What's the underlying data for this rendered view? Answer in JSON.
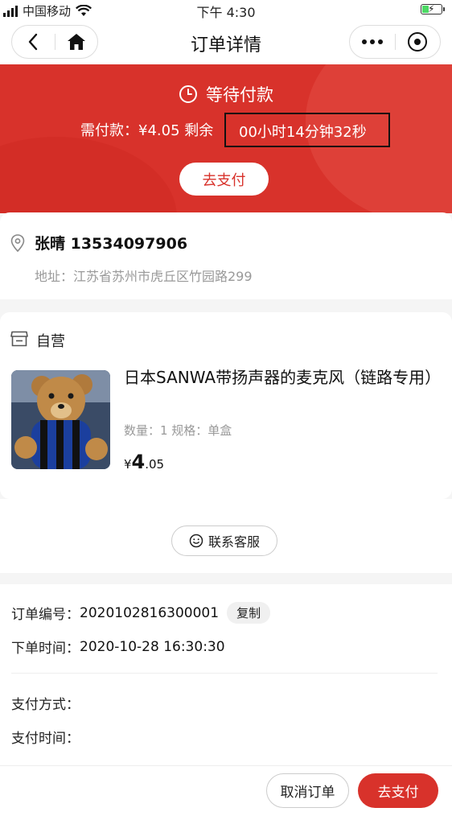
{
  "status_bar": {
    "carrier": "中国移动",
    "time": "下午 4:30",
    "battery_icon": "battery-charging-icon"
  },
  "nav": {
    "title": "订单详情",
    "back_icon": "back-arrow-icon",
    "home_icon": "home-icon",
    "more_icon": "more-dots-icon",
    "close_icon": "mini-program-close-icon"
  },
  "order_status": {
    "title": "等待付款",
    "amount_label": "需付款：¥4.05 剩余",
    "countdown": "00小时14分钟32秒",
    "pay_button": "去支付"
  },
  "address": {
    "recipient": "张晴 13534097906",
    "address_line": "地址：江苏省苏州市虎丘区竹园路299"
  },
  "product": {
    "shop_name": "自营",
    "title": "日本SANWA带扬声器的麦克风（链路专用）",
    "spec": "数量：1 规格：单盒",
    "price_currency": "¥",
    "price_int": "4",
    "price_dec": ".05"
  },
  "service": {
    "label": "联系客服"
  },
  "order_info": {
    "order_no_label": "订单编号：",
    "order_no": "2020102816300001",
    "copy_label": "复制",
    "order_time_label": "下单时间：",
    "order_time": "2020-10-28 16:30:30",
    "pay_method_label": "支付方式：",
    "pay_time_label": "支付时间："
  },
  "bottom_bar": {
    "cancel_label": "取消订单",
    "pay_label": "去支付"
  },
  "colors": {
    "accent": "#d8322b",
    "background": "#f5f5f5"
  }
}
